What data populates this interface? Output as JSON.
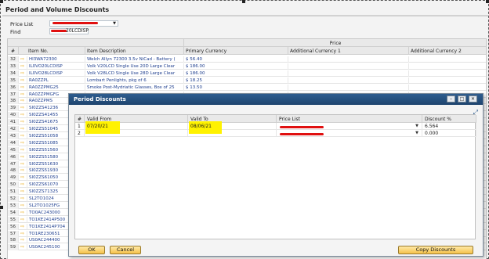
{
  "window": {
    "title": "Period and Volume Discounts"
  },
  "header": {
    "price_list_label": "Price List",
    "find_label": "Find",
    "find_value": "20LCDISP"
  },
  "grid": {
    "group_header": "Price",
    "columns": [
      "#",
      "Item No.",
      "Item Description",
      "Primary Currency",
      "Additional Currency 1",
      "Additional Currency 2"
    ],
    "rows": [
      {
        "n": "32",
        "item": "HI3WA72300",
        "desc": "Welch Allyn 72300 3.5v NiCad - Battery (",
        "price": "$ 56.40"
      },
      {
        "n": "33",
        "item": "IL0VO20LCDISP",
        "desc": "Volk V20LCD Single Use 20D Large Clear",
        "price": "$ 186.00"
      },
      {
        "n": "34",
        "item": "IL0VO28LCDISP",
        "desc": "Volk V28LCD Single Use 28D Large Clear",
        "price": "$ 186.00"
      },
      {
        "n": "35",
        "item": "RA0ZZPL",
        "desc": "Lombart Penlights, pkg of 6",
        "price": "$ 18.25"
      },
      {
        "n": "36",
        "item": "RA0ZZPMG25",
        "desc": "Smoke Post-Mydriatic Glasses, Box of 25",
        "price": "$ 13.50"
      },
      {
        "n": "37",
        "item": "RA0ZZPMGFG",
        "desc": "",
        "price": ""
      },
      {
        "n": "38",
        "item": "RA0ZZPMS",
        "desc": "",
        "price": ""
      },
      {
        "n": "39",
        "item": "SI0ZZS41236",
        "desc": "",
        "price": ""
      },
      {
        "n": "40",
        "item": "SI0ZZS41455",
        "desc": "",
        "price": ""
      },
      {
        "n": "41",
        "item": "SI0ZZS41675",
        "desc": "",
        "price": ""
      },
      {
        "n": "42",
        "item": "SI0ZZS51045",
        "desc": "",
        "price": ""
      },
      {
        "n": "43",
        "item": "SI0ZZS51058",
        "desc": "",
        "price": ""
      },
      {
        "n": "44",
        "item": "SI0ZZS51085",
        "desc": "",
        "price": ""
      },
      {
        "n": "45",
        "item": "SI0ZZS51560",
        "desc": "",
        "price": ""
      },
      {
        "n": "46",
        "item": "SI0ZZS51580",
        "desc": "",
        "price": ""
      },
      {
        "n": "47",
        "item": "SI0ZZS51630",
        "desc": "",
        "price": ""
      },
      {
        "n": "48",
        "item": "SI0ZZS51930",
        "desc": "",
        "price": ""
      },
      {
        "n": "49",
        "item": "SI0ZZS61050",
        "desc": "",
        "price": ""
      },
      {
        "n": "50",
        "item": "SI0ZZS61070",
        "desc": "",
        "price": ""
      },
      {
        "n": "51",
        "item": "SI0ZZS71325",
        "desc": "",
        "price": ""
      },
      {
        "n": "52",
        "item": "SL2TO1024",
        "desc": "",
        "price": ""
      },
      {
        "n": "53",
        "item": "SL2TO1025FG",
        "desc": "",
        "price": ""
      },
      {
        "n": "54",
        "item": "TO0AC243000",
        "desc": "",
        "price": ""
      },
      {
        "n": "55",
        "item": "TO1KE2414P500",
        "desc": "",
        "price": ""
      },
      {
        "n": "56",
        "item": "TO1KE2414P704",
        "desc": "",
        "price": ""
      },
      {
        "n": "57",
        "item": "TO1RE230651",
        "desc": "",
        "price": ""
      },
      {
        "n": "58",
        "item": "US0AC244400",
        "desc": "",
        "price": ""
      },
      {
        "n": "59",
        "item": "US0AC245100",
        "desc": "",
        "price": ""
      }
    ]
  },
  "dialog": {
    "title": "Period Discounts",
    "columns": [
      "#",
      "Valid From",
      "Valid To",
      "Price List",
      "Discount %"
    ],
    "rows": [
      {
        "n": "1",
        "from": "07/20/21",
        "to": "08/06/21",
        "discount": "6.564"
      },
      {
        "n": "2",
        "from": "",
        "to": "",
        "discount": "0.000"
      }
    ],
    "ok_label": "OK",
    "cancel_label": "Cancel",
    "copy_label": "Copy Discounts"
  }
}
